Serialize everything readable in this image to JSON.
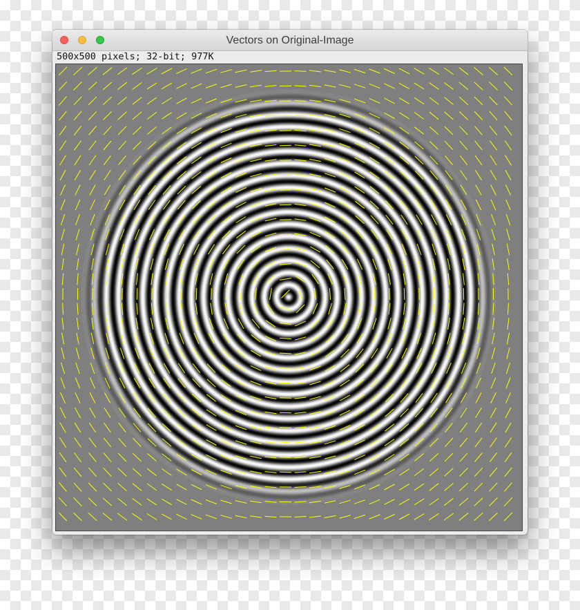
{
  "window": {
    "title": "Vectors on Original-Image",
    "info": "500x500 pixels; 32-bit; 977K"
  },
  "image": {
    "background_color": "#7f7f7f",
    "ring_color_light": "#ffffff",
    "ring_color_dark": "#000000",
    "vector_color": "#ffff00"
  },
  "colors": {
    "close": "#fc605c",
    "minimize": "#fdbc40",
    "maximize": "#34c84a"
  }
}
